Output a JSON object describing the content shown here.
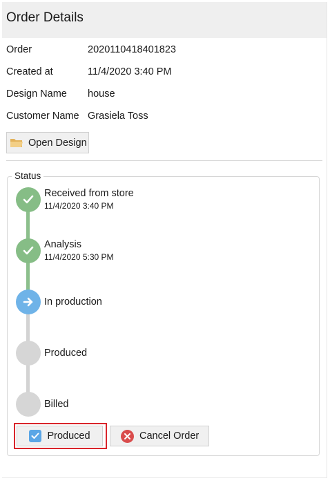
{
  "header": {
    "title": "Order Details"
  },
  "order_info": [
    {
      "label": "Order",
      "value": "2020110418401823"
    },
    {
      "label": "Created at",
      "value": "11/4/2020 3:40 PM"
    },
    {
      "label": "Design Name",
      "value": "house"
    },
    {
      "label": "Customer Name",
      "value": "Grasiela Toss"
    }
  ],
  "open_design": {
    "label": "Open Design",
    "icon": "folder-icon"
  },
  "status": {
    "group_label": "Status",
    "steps": [
      {
        "label": "Received from store",
        "date": "11/4/2020 3:40 PM",
        "state": "done",
        "icon": "check-icon"
      },
      {
        "label": "Analysis",
        "date": "11/4/2020 5:30 PM",
        "state": "done",
        "icon": "check-icon"
      },
      {
        "label": "In production",
        "date": "",
        "state": "active",
        "icon": "arrow-right-icon"
      },
      {
        "label": "Produced",
        "date": "",
        "state": "pending",
        "icon": ""
      },
      {
        "label": "Billed",
        "date": "",
        "state": "pending",
        "icon": ""
      }
    ]
  },
  "actions": {
    "produced_label": "Produced",
    "cancel_label": "Cancel Order"
  },
  "colors": {
    "done": "#86bd86",
    "active": "#6fb3e8",
    "pending": "#d6d6d6",
    "highlight": "#d9252b"
  }
}
